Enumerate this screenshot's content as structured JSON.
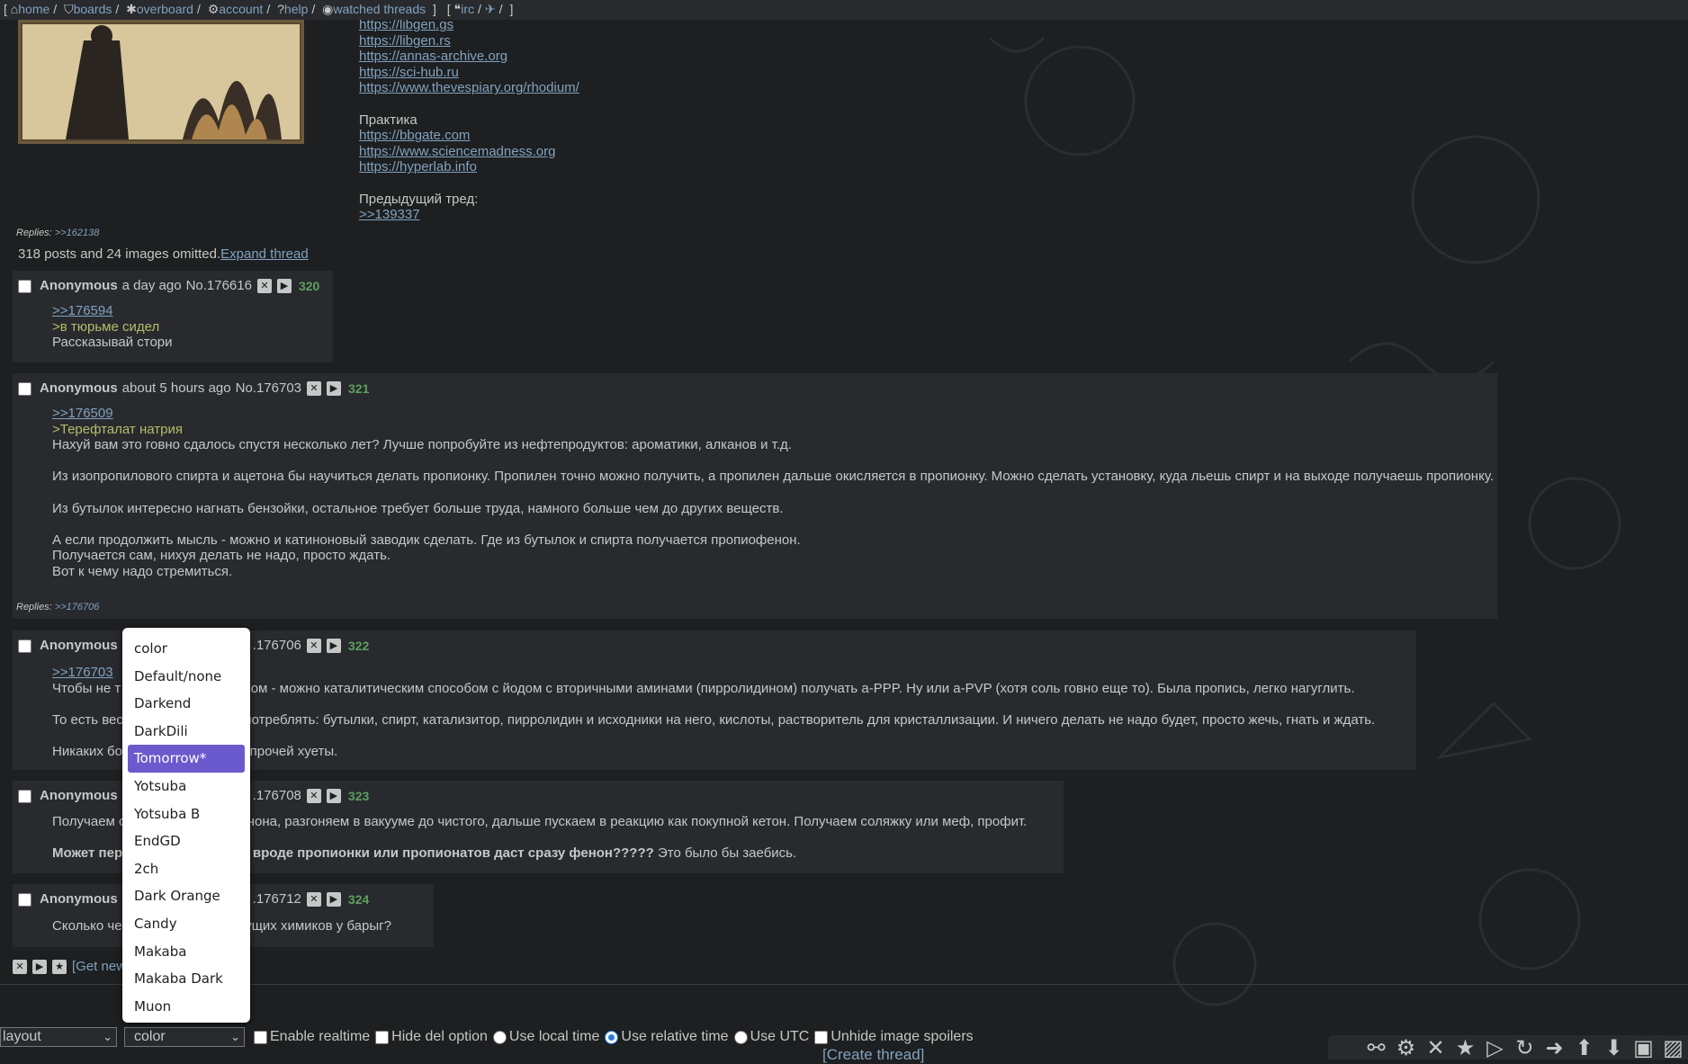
{
  "nav": {
    "bracket_open": "[",
    "items": [
      {
        "icon": "home-icon",
        "label": "home"
      },
      {
        "icon": "tags-icon",
        "label": "boards"
      },
      {
        "icon": "asterisk-icon",
        "label": "overboard"
      },
      {
        "icon": "gear-icon",
        "label": "account"
      },
      {
        "icon": "question-icon",
        "label": "help"
      },
      {
        "icon": "eye-icon",
        "label": "watched threads"
      }
    ],
    "bracket_close": "]",
    "irc": "irc"
  },
  "op": {
    "links": [
      "https://libgen.gs",
      "https://libgen.rs",
      "https://annas-archive.org",
      "https://sci-hub.ru",
      "https://www.thevespiary.org/rhodium/"
    ],
    "practice_label": "Практика",
    "practice_links": [
      "https://bbgate.com",
      "https://www.sciencemadness.org",
      "https://hyperlab.info"
    ],
    "prev_thread_label": "Предыдущий тред:",
    "prev_thread_link": ">>139337",
    "replies_label": "Replies:",
    "replies_link": ">>162138"
  },
  "omitted": {
    "text": "318 posts and 24 images omitted.",
    "expand": "Expand thread"
  },
  "posts": [
    {
      "name": "Anonymous",
      "time": "a day ago",
      "no": "No.176616",
      "count": "320",
      "lines": [
        {
          "t": ">>176594",
          "type": "link"
        },
        {
          "t": ">в тюрьме сидел",
          "type": "green"
        },
        {
          "t": "Рассказывай стори",
          "type": "text"
        }
      ]
    },
    {
      "name": "Anonymous",
      "time": "about 5 hours ago",
      "no": "No.176703",
      "count": "321",
      "lines": [
        {
          "t": ">>176509",
          "type": "link"
        },
        {
          "t": ">Терефталат натрия",
          "type": "green"
        },
        {
          "t": "Нахуй вам это говно сдалось спустя несколько лет? Лучше попробуйте из нефтепродуктов: ароматики, алканов и т.д.",
          "type": "text"
        },
        {
          "t": "",
          "type": "text"
        },
        {
          "t": "Из изопропилового спирта и ацетона бы научиться делать пропионку. Пропилен точно можно получить, а пропилен дальше окисляется в пропионку. Можно сделать установку, куда льешь спирт и на выходе получаешь пропионку.",
          "type": "text"
        },
        {
          "t": "",
          "type": "text"
        },
        {
          "t": "Из бутылок интересно нагнать бензойки, остальное требует больше труда, намного больше чем до других веществ.",
          "type": "text"
        },
        {
          "t": "",
          "type": "text"
        },
        {
          "t": "А если продолжить мысль - можно и катиноновый заводик сделать. Где из бутылок и спирта получается пропиофенон.",
          "type": "text"
        },
        {
          "t": "Получается сам, нихуя делать не надо, просто ждать.",
          "type": "text"
        },
        {
          "t": "Вот к чему надо стремиться.",
          "type": "text"
        }
      ],
      "replies_label": "Replies:",
      "replies_link": ">>176706"
    },
    {
      "name": "Anonymous",
      "time": "",
      "no": ".176706",
      "count": "322",
      "lines": [
        {
          "t": ">>176703",
          "type": "link"
        },
        {
          "t": "Чтобы не т                        ы и бром - можно каталитическим способом с йодом с вторичными аминами (пирролидином) получать a-PPP. Ну или a-PVP (хотя соль говно еще то). Была пропись, легко нагуглить.",
          "type": "text"
        },
        {
          "t": "",
          "type": "text"
        },
        {
          "t": "То есть вес                        удет потреблять: бутылки, спирт, катализитор, пирролидин и исходники на него, кислоты, растворитель для кристаллизации. И ничего делать не надо будет, просто жечь, гнать и ждать.",
          "type": "text"
        },
        {
          "t": "",
          "type": "text"
        },
        {
          "t": "Никаких бо                        бов и прочей хуеты.",
          "type": "text"
        }
      ]
    },
    {
      "name": "Anonymous",
      "time": "",
      "no": ".176708",
      "count": "323",
      "lines": [
        {
          "t": "Получаем с                        м фенона, разгоняем в вакууме до чистого, дальше пускаем в реакцию как покупной кетон. Получаем соляжку или меф, профит.",
          "type": "text"
        },
        {
          "t": "",
          "type": "text"
        },
        {
          "bold": "Может пер                        ем-то вроде пропионки или пропионатов даст сразу фенон?????",
          "t": " Это было бы заебись.",
          "type": "mixed"
        }
      ]
    },
    {
      "name": "Anonymous",
      "time": "",
      "no": ".176712",
      "count": "324",
      "lines": [
        {
          "t": "Сколько че                        о будущих химиков у барыг?",
          "type": "text"
        }
      ]
    }
  ],
  "thread_actions": {
    "get_new": "[Get new"
  },
  "controls": {
    "layout_value": "layout",
    "color_value": "color",
    "enable_realtime": "Enable realtime",
    "hide_del": "Hide del option",
    "use_local_time": "Use local time",
    "use_relative_time": "Use relative time",
    "use_utc": "Use UTC",
    "unhide_spoilers": "Unhide image spoilers",
    "relative_time_selected": true
  },
  "create_thread": "[Create thread]",
  "color_dropdown": {
    "options": [
      "color",
      "Default/none",
      "Darkend",
      "DarkDili",
      "Tomorrow*",
      "Yotsuba",
      "Yotsuba B",
      "EndGD",
      "2ch",
      "Dark Orange",
      "Candy",
      "Makaba",
      "Makaba Dark",
      "Muon"
    ],
    "selected": "Tomorrow*"
  },
  "toolbar_icons": [
    "link-icon",
    "gear-icon",
    "close-icon",
    "star-icon",
    "play-icon",
    "refresh-icon",
    "arrow-right-icon",
    "arrow-up-icon",
    "arrow-down-icon",
    "image-icon",
    "pattern-icon"
  ],
  "theme": {
    "background": "#1d1f21",
    "post_bg": "#282a2e",
    "link": "#81a2be",
    "greentext": "#b5bd68",
    "count": "#5f9f5f",
    "selected": "#6a5acd"
  }
}
